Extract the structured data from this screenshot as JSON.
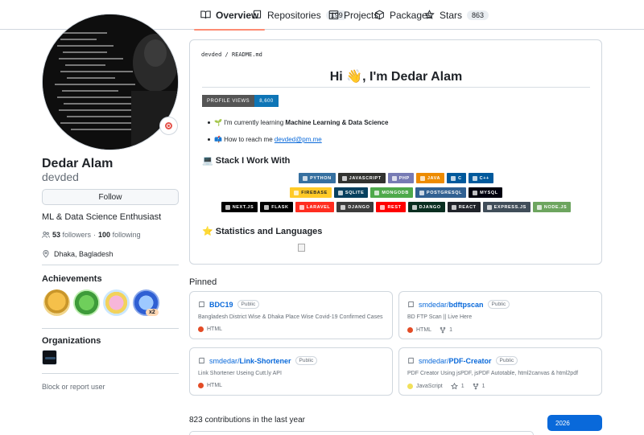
{
  "tabs": [
    {
      "label": "Overview",
      "icon": "book-icon",
      "count": ""
    },
    {
      "label": "Repositories",
      "icon": "repo-icon",
      "count": "199"
    },
    {
      "label": "Projects",
      "icon": "table-icon",
      "count": ""
    },
    {
      "label": "Packages",
      "icon": "package-icon",
      "count": ""
    },
    {
      "label": "Stars",
      "icon": "star-icon",
      "count": "863"
    }
  ],
  "profile": {
    "name": "Dedar Alam",
    "login": "devded",
    "follow_label": "Follow",
    "bio": "ML & Data Science Enthusiast",
    "followers": "53",
    "followers_label": "followers",
    "dot": "·",
    "following": "100",
    "following_label": "following",
    "location": "Dhaka, Bagladesh",
    "achievements_heading": "Achievements",
    "achievement_multiplier": "x2",
    "organizations_heading": "Organizations",
    "block_label": "Block or report user"
  },
  "readme": {
    "path_user": "devded",
    "path_sep": " / ",
    "path_file": "README.md",
    "greeting": "Hi 👋, I'm Dedar Alam",
    "views_label": "PROFILE VIEWS",
    "views_value": "8,600",
    "learning_prefix": "🌱 I'm currently learning ",
    "learning_topic": "Machine Learning & Data Science",
    "reach_prefix": "📫 How to reach me ",
    "reach_email": "devded@pm.me",
    "stack_heading": "💻 Stack I Work With",
    "stats_heading": "⭐ Statistics and Languages",
    "shields_row1": [
      {
        "label": "PYTHON",
        "color": "#3670a0"
      },
      {
        "label": "JAVASCRIPT",
        "color": "#323330"
      },
      {
        "label": "PHP",
        "color": "#777bb4"
      },
      {
        "label": "JAVA",
        "color": "#ed8b00"
      },
      {
        "label": "C",
        "color": "#00599c"
      },
      {
        "label": "C++",
        "color": "#00599c"
      }
    ],
    "shields_row2": [
      {
        "label": "FIREBASE",
        "color": "#ffca28"
      },
      {
        "label": "SQLITE",
        "color": "#07405e"
      },
      {
        "label": "MONGODB",
        "color": "#4ea94b"
      },
      {
        "label": "POSTGRESQL",
        "color": "#316192"
      },
      {
        "label": "MYSQL",
        "color": "#00000f"
      }
    ],
    "shields_row3": [
      {
        "label": "NEXT.JS",
        "color": "#000000"
      },
      {
        "label": "FLASK",
        "color": "#000000"
      },
      {
        "label": "LARAVEL",
        "color": "#ff2d20"
      },
      {
        "label": "DJANGO",
        "color": "#3c3c3c"
      },
      {
        "label": "REST",
        "color": "#ff0000"
      },
      {
        "label": "DJANGO",
        "color": "#092e20"
      },
      {
        "label": "REACT",
        "color": "#20232a"
      },
      {
        "label": "EXPRESS.JS",
        "color": "#404d59"
      },
      {
        "label": "NODE.JS",
        "color": "#6da55f"
      }
    ]
  },
  "pinned": {
    "heading": "Pinned",
    "repos": [
      {
        "owner": "",
        "name": "BDC19",
        "visibility": "Public",
        "description": "Bangladesh District Wise & Dhaka Place Wise Covid-19 Confirmed Cases",
        "language": "HTML",
        "lang_color": "#e34c26",
        "stars": "",
        "forks": ""
      },
      {
        "owner": "smdedar/",
        "name": "bdftpscan",
        "visibility": "Public",
        "description": "BD FTP Scan || Live Here",
        "language": "HTML",
        "lang_color": "#e34c26",
        "stars": "",
        "forks": "1"
      },
      {
        "owner": "smdedar/",
        "name": "Link-Shortener",
        "visibility": "Public",
        "description": "Link Shortener Useing Cutt.ly API",
        "language": "HTML",
        "lang_color": "#e34c26",
        "stars": "",
        "forks": ""
      },
      {
        "owner": "smdedar/",
        "name": "PDF-Creator",
        "visibility": "Public",
        "description": "PDF Creator Using jsPDF, jsPDF Autotable, html2canvas & html2pdf",
        "language": "JavaScript",
        "lang_color": "#f1e05a",
        "stars": "1",
        "forks": "1"
      }
    ]
  },
  "contributions": {
    "summary": "823 contributions in the last year",
    "year": "2026"
  }
}
